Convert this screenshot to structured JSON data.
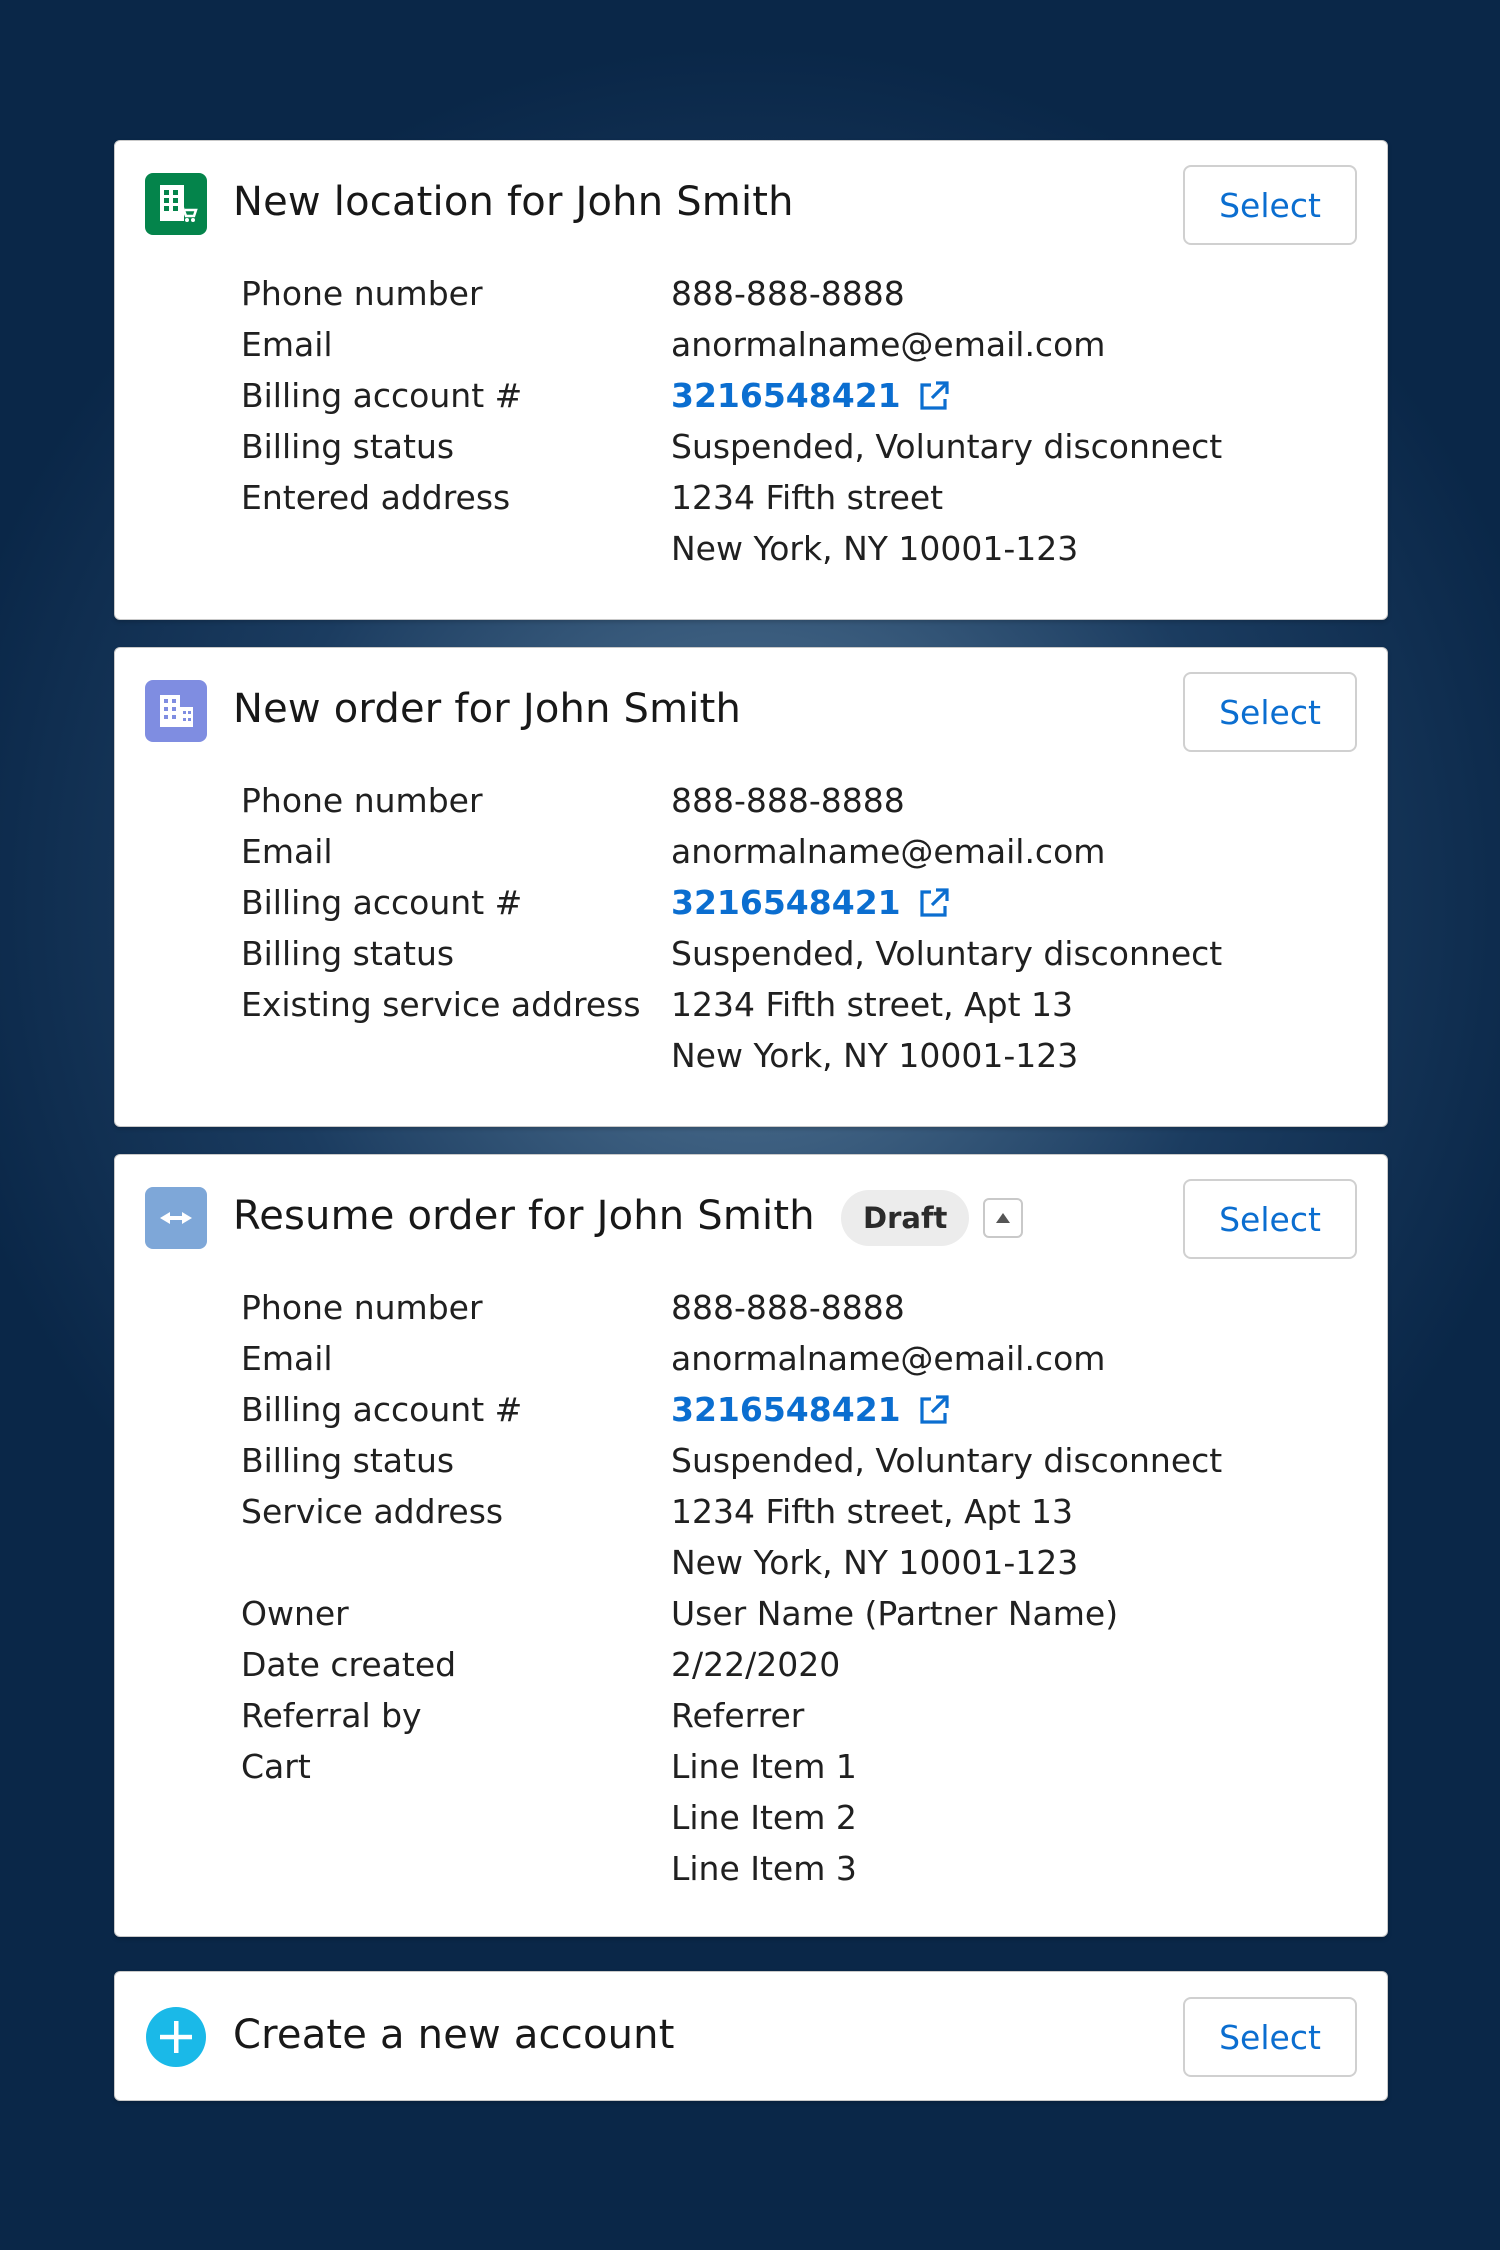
{
  "cards": [
    {
      "title": "New location for John Smith",
      "select_label": "Select",
      "icon": "building-cart-icon",
      "icon_color": "#04844b",
      "rows": [
        {
          "label": "Phone number",
          "value": "888-888-8888"
        },
        {
          "label": "Email",
          "value": "anormalname@email.com"
        },
        {
          "label": "Billing account #",
          "value": "3216548421",
          "link": true
        },
        {
          "label": "Billing status",
          "value": "Suspended, Voluntary disconnect"
        },
        {
          "label": "Entered address",
          "value": "1234 Fifth street"
        },
        {
          "label": "",
          "value": "New York, NY 10001-123"
        }
      ]
    },
    {
      "title": "New order for John Smith",
      "select_label": "Select",
      "icon": "building-icon",
      "icon_color": "#7f8de1",
      "rows": [
        {
          "label": "Phone number",
          "value": "888-888-8888"
        },
        {
          "label": "Email",
          "value": "anormalname@email.com"
        },
        {
          "label": "Billing account #",
          "value": "3216548421",
          "link": true
        },
        {
          "label": "Billing status",
          "value": "Suspended, Voluntary disconnect"
        },
        {
          "label": "Existing service address",
          "value": "1234 Fifth street, Apt 13"
        },
        {
          "label": "",
          "value": "New York, NY 10001-123"
        }
      ]
    },
    {
      "title": "Resume order for John Smith",
      "badge": "Draft",
      "select_label": "Select",
      "icon": "collapse-arrows-icon",
      "icon_color": "#7ea7d8",
      "rows": [
        {
          "label": "Phone number",
          "value": "888-888-8888"
        },
        {
          "label": "Email",
          "value": "anormalname@email.com"
        },
        {
          "label": "Billing account #",
          "value": "3216548421",
          "link": true
        },
        {
          "label": "Billing status",
          "value": "Suspended, Voluntary disconnect"
        },
        {
          "label": "Service address",
          "value": "1234 Fifth street, Apt 13"
        },
        {
          "label": "",
          "value": "New York, NY 10001-123"
        },
        {
          "label": "Owner",
          "value": "User Name (Partner Name)"
        },
        {
          "label": "Date created",
          "value": "2/22/2020"
        },
        {
          "label": "Referral by",
          "value": "Referrer"
        },
        {
          "label": "Cart",
          "value": "Line Item 1"
        },
        {
          "label": "",
          "value": "Line Item 2"
        },
        {
          "label": "",
          "value": "Line Item 3"
        }
      ]
    },
    {
      "title": "Create a new account",
      "select_label": "Select",
      "icon": "plus-circle-icon",
      "icon_color": "#1ab9e8"
    }
  ],
  "colors": {
    "link": "#0b6ed0",
    "background": "#0a2748"
  }
}
